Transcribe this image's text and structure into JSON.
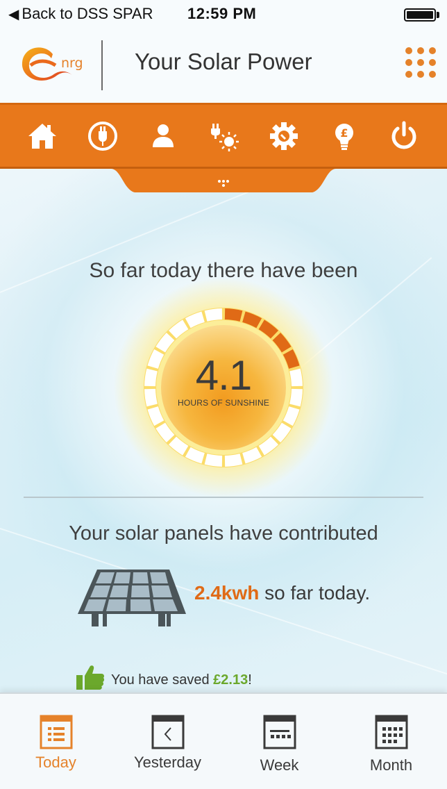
{
  "status_bar": {
    "back_label": "Back to DSS SPAR",
    "time": "12:59 PM"
  },
  "header": {
    "logo_text": "nrg",
    "title": "Your Solar Power"
  },
  "nav": {
    "items": [
      "home-icon",
      "plug-icon",
      "user-icon",
      "solar-plug-icon",
      "gear-icon",
      "lightbulb-pound-icon",
      "power-icon"
    ]
  },
  "main": {
    "intro": "So far today there have been",
    "sunshine_hours": "4.1",
    "sunshine_label": "HOURS OF SUNSHINE",
    "sunshine_progress_segments_lit": 5,
    "contrib_heading": "Your solar panels have contributed",
    "energy_value": "2.4kwh",
    "energy_suffix": " so far today.",
    "saved_prefix": "You have saved ",
    "saved_amount": "£2.13",
    "saved_suffix": "!"
  },
  "tabs": [
    {
      "label": "Today",
      "active": true
    },
    {
      "label": "Yesterday",
      "active": false
    },
    {
      "label": "Week",
      "active": false
    },
    {
      "label": "Month",
      "active": false
    }
  ],
  "colors": {
    "brand_orange": "#e8781b",
    "accent_green": "#6ba82c"
  }
}
